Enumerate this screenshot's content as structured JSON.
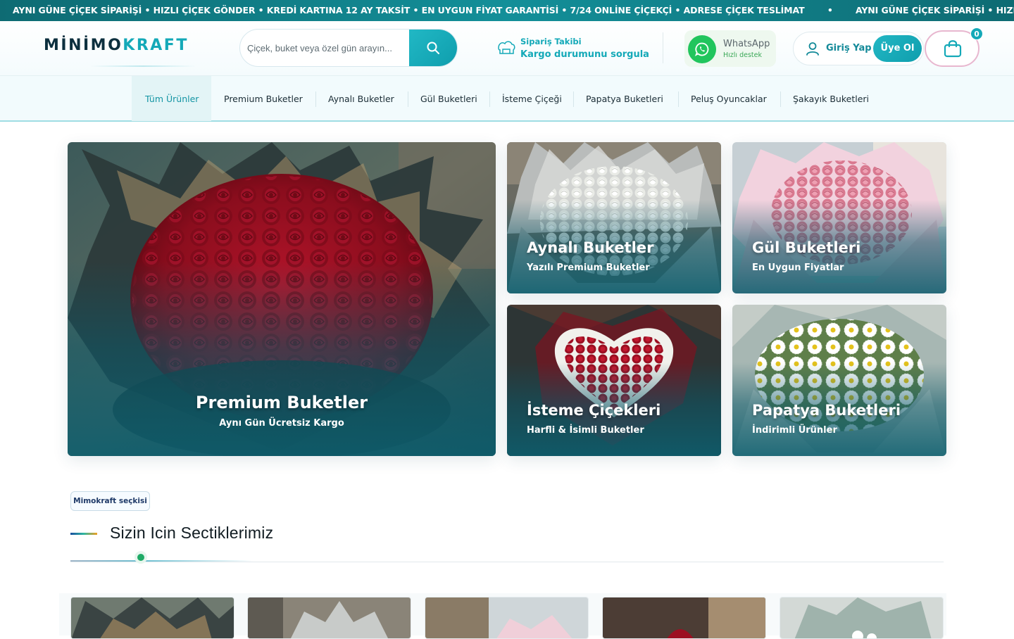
{
  "ticker": {
    "items": [
      "AYNI GÜNE ÇİÇEK SİPARİŞİ • HIZLI ÇİÇEK GÖNDER • KREDİ KARTINA 12 AY TAKSİT • EN UYGUN FİYAT GARANTİSİ • 7/24 ONLİNE ÇİÇEKÇİ • ADRESE ÇİÇEK TESLİMAT",
      "•",
      "AYNI GÜNE ÇİÇEK SİPARİŞİ • HIZLI ÇİÇEK GÖNDI"
    ]
  },
  "header": {
    "logo_prefix": "MİNİMO",
    "logo_suffix": "KRAFT",
    "search_placeholder": "Çiçek, buket veya özel gün arayın...",
    "tracking_label": "Sipariş Takibi",
    "tracking_link": "Kargo durumunu sorgula",
    "whatsapp_label": "WhatsApp",
    "whatsapp_sub": "Hızlı destek",
    "login_label": "Giriş Yap",
    "signup_label": "Üye Ol",
    "cart_count": "0"
  },
  "nav": {
    "items": [
      "Tüm Ürünler",
      "Premium Buketler",
      "Aynalı Buketler",
      "Gül Buketleri",
      "İsteme Çiçeği",
      "Papatya Buketleri",
      "Peluş Oyuncaklar",
      "Şakayık Buketleri"
    ],
    "active": "Tüm Ürünler"
  },
  "hero": {
    "main": {
      "title": "Premium Buketler",
      "subtitle": "Aynı Gün Ücretsiz Kargo"
    },
    "tiles": [
      {
        "title": "Aynalı Buketler",
        "subtitle": "Yazılı Premium Buketler"
      },
      {
        "title": "Gül Buketleri",
        "subtitle": "En Uygun Fiyatlar"
      },
      {
        "title": "İsteme Çiçekleri",
        "subtitle": "Harfli & İsimli Buketler"
      },
      {
        "title": "Papatya Buketleri",
        "subtitle": "İndirimli Ürünler"
      }
    ]
  },
  "section": {
    "badge": "Mimokraft seçkisi",
    "title": "Sizin Icin Sectiklerimiz"
  },
  "colors": {
    "accent": "#14a9b8",
    "ticker_bg": "#0e6b73",
    "whatsapp": "#21c55d",
    "rose_red": "#9b1020",
    "rose_pink": "#e38aa6"
  }
}
